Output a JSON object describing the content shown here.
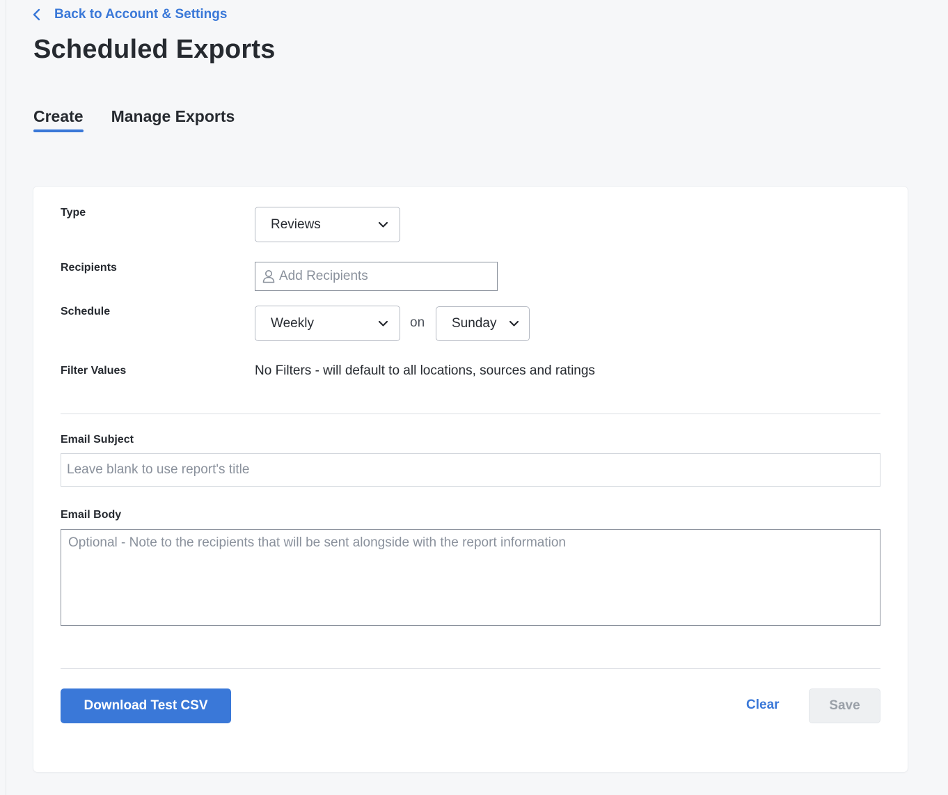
{
  "nav": {
    "back_label": "Back to Account & Settings"
  },
  "page": {
    "title": "Scheduled Exports"
  },
  "tabs": [
    {
      "label": "Create",
      "active": true
    },
    {
      "label": "Manage Exports",
      "active": false
    }
  ],
  "form": {
    "type": {
      "label": "Type",
      "value": "Reviews"
    },
    "recipients": {
      "label": "Recipients",
      "placeholder": "Add Recipients"
    },
    "schedule": {
      "label": "Schedule",
      "frequency": "Weekly",
      "connector": "on",
      "day": "Sunday"
    },
    "filters": {
      "label": "Filter Values",
      "value": "No Filters - will default to all locations, sources and ratings"
    },
    "email_subject": {
      "label": "Email Subject",
      "placeholder": "Leave blank to use report's title",
      "value": ""
    },
    "email_body": {
      "label": "Email Body",
      "placeholder": "Optional - Note to the recipients that will be sent alongside with the report information",
      "value": ""
    }
  },
  "actions": {
    "download_label": "Download Test CSV",
    "clear_label": "Clear",
    "save_label": "Save"
  },
  "icons": {
    "back": "chevron-left-icon",
    "dropdown": "chevron-down-icon",
    "recipients": "user-icon"
  },
  "colors": {
    "accent": "#3a78d8",
    "text": "#262a30",
    "background": "#f6f7f9",
    "disabled_bg": "#eef0f2",
    "disabled_text": "#9aa0a8"
  }
}
